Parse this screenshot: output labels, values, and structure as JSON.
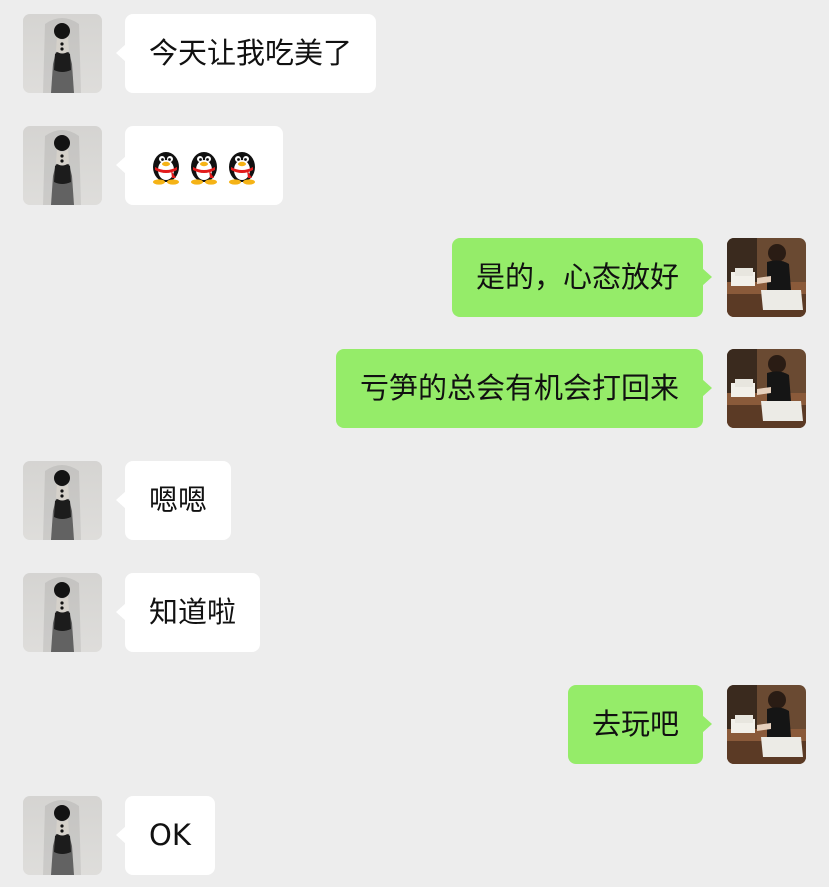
{
  "chat": {
    "messages": [
      {
        "side": "in",
        "text": "今天让我吃美了"
      },
      {
        "side": "in",
        "emoji": [
          "penguin-icon",
          "penguin-icon",
          "penguin-icon"
        ]
      },
      {
        "side": "out",
        "text": "是的，心态放好"
      },
      {
        "side": "out",
        "text": "亏笋的总会有机会打回来"
      },
      {
        "side": "in",
        "text": "嗯嗯"
      },
      {
        "side": "in",
        "text": "知道啦"
      },
      {
        "side": "out",
        "text": "去玩吧"
      },
      {
        "side": "in",
        "text": "OK"
      }
    ]
  },
  "colors": {
    "background": "#ededed",
    "incoming_bubble": "#ffffff",
    "outgoing_bubble": "#95ec69",
    "text": "#111111"
  }
}
